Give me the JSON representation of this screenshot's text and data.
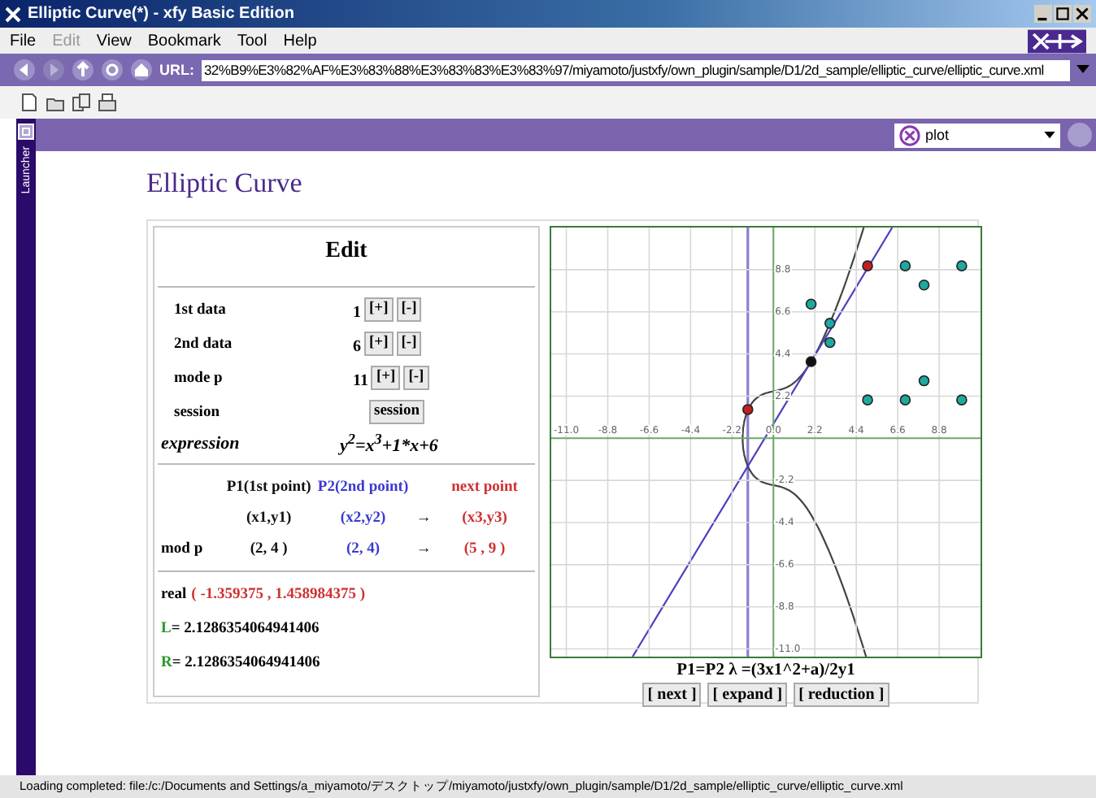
{
  "window": {
    "title": "Elliptic Curve(*) - xfy Basic Edition"
  },
  "menu": [
    {
      "label": "File",
      "disabled": false
    },
    {
      "label": "Edit",
      "disabled": true
    },
    {
      "label": "View",
      "disabled": false
    },
    {
      "label": "Bookmark",
      "disabled": false
    },
    {
      "label": "Tool",
      "disabled": false
    },
    {
      "label": "Help",
      "disabled": false
    }
  ],
  "address_bar": {
    "label": "URL:",
    "value": "32%B9%E3%82%AF%E3%83%88%E3%83%83%E3%83%97/miyamoto/justxfy/own_plugin/sample/D1/2d_sample/elliptic_curve/elliptic_curve.xml"
  },
  "plugin_select": {
    "value": "plot"
  },
  "side_tab": {
    "label": "Launcher"
  },
  "page": {
    "heading": "Elliptic Curve",
    "edit_panel": {
      "title": "Edit",
      "rows": [
        {
          "kind": "stepper",
          "label": "1st data",
          "value": "1",
          "buttons": [
            "[+]",
            "[-]"
          ]
        },
        {
          "kind": "stepper",
          "label": "2nd data",
          "value": "6",
          "buttons": [
            "[+]",
            "[-]"
          ]
        },
        {
          "kind": "stepper",
          "label": "mode p",
          "value": "11",
          "buttons": [
            "[+]",
            "[-]"
          ]
        },
        {
          "kind": "button",
          "label": "session",
          "buttons": [
            "session"
          ]
        },
        {
          "kind": "formula",
          "label": "expression",
          "value": "y$^{2}$=x$^{3}$+1*x+6"
        }
      ],
      "points_table": {
        "headers": [
          {
            "text": "P1(1st point)",
            "color": "#111111"
          },
          {
            "text": "P2(2nd point)",
            "color": "#3a3ad0"
          },
          {
            "text": "next point",
            "color": "#d03030"
          }
        ],
        "rows": [
          {
            "label": "",
            "cells": [
              "(x1,y1)",
              "(x2,y2)",
              "(x3,y3)"
            ],
            "arrow": "→"
          },
          {
            "label": "mod p",
            "cells": [
              "(2, 4 )",
              "(2, 4)",
              "(5 , 9 )"
            ],
            "arrow": "→"
          }
        ]
      },
      "real": {
        "label": "real",
        "value": "( -1.359375 , 1.458984375 )"
      },
      "results": [
        {
          "name": "L",
          "value": " = 2.1286354064941406"
        },
        {
          "name": "R",
          "value": " = 2.1286354064941406"
        }
      ]
    },
    "plot": {
      "chart_data": {
        "type": "scatter",
        "grid": true,
        "xlim": [
          -11.8,
          11
        ],
        "ylim": [
          -11.4,
          11
        ],
        "xticks": [
          {
            "value": -11,
            "label": "-11.0"
          },
          {
            "value": -8.8,
            "label": "-8.8"
          },
          {
            "value": -6.6,
            "label": "-6.6"
          },
          {
            "value": -4.4,
            "label": "-4.4"
          },
          {
            "value": -2.2,
            "label": "-2.2"
          },
          {
            "value": 0,
            "label": "0.0"
          },
          {
            "value": 2.2,
            "label": "2.2"
          },
          {
            "value": 4.4,
            "label": "4.4"
          },
          {
            "value": 6.6,
            "label": "6.6"
          },
          {
            "value": 8.8,
            "label": "8.8"
          }
        ],
        "yticks": [
          {
            "value": 8.8,
            "label": "8.8"
          },
          {
            "value": 6.6,
            "label": "6.6"
          },
          {
            "value": 4.4,
            "label": "4.4"
          },
          {
            "value": 2.2,
            "label": "2.2"
          },
          {
            "value": -2.2,
            "label": "-2.2"
          },
          {
            "value": -4.4,
            "label": "-4.4"
          },
          {
            "value": -6.6,
            "label": "-6.6"
          },
          {
            "value": -8.8,
            "label": "-8.8"
          },
          {
            "value": -11,
            "label": "-11.0"
          }
        ],
        "x": [
          -1.36,
          2,
          2,
          3,
          3,
          5,
          5,
          7,
          7,
          8,
          8,
          10,
          10
        ],
        "series": [
          {
            "color": "#1fa8a0",
            "values": [
              null,
              null,
              7,
              5,
              6,
              2,
              null,
              2,
              9,
              3,
              8,
              2,
              9
            ]
          },
          {
            "color": "#c02020",
            "values": [
              1.5,
              null,
              null,
              null,
              null,
              null,
              9,
              null,
              null,
              null,
              null,
              null,
              null
            ]
          },
          {
            "color": "#111111",
            "values": [
              null,
              4,
              null,
              null,
              null,
              null,
              null,
              null,
              null,
              null,
              null,
              null,
              null
            ]
          }
        ]
      },
      "formula": "P1=P2  λ =(3x1^2+a)/2y1",
      "buttons": [
        "[ next ]",
        "[ expand ]",
        "[ reduction ]"
      ]
    }
  },
  "status_bar": "Loading completed: file:/c:/Documents and Settings/a_miyamoto/デスクトップ/miyamoto/justxfy/own_plugin/sample/D1/2d_sample/elliptic_curve/elliptic_curve.xml"
}
